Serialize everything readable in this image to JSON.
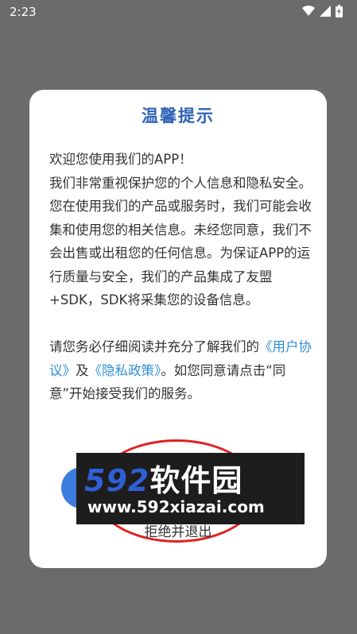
{
  "status_bar": {
    "time": "2:23"
  },
  "dialog": {
    "title": "温馨提示",
    "p1": "欢迎您使用我们的APP！",
    "p2": "我们非常重视保护您的个人信息和隐私安全。您在使用我们的产品或服务时，我们可能会收集和使用您的相关信息。未经您同意，我们不会出售或出租您的任何信息。为保证APP的运行质量与安全，我们的产品集成了友盟+SDK，SDK将采集您的设备信息。",
    "p3_before": "请您务必仔细阅读并充分了解我们的",
    "user_agreement_link": "《用户协议》",
    "and": "及",
    "privacy_policy_link": "《隐私政策》",
    "p3_after": "。如您同意请点击“同意”开始接受我们的服务。",
    "decline_label": "拒绝并退出"
  },
  "watermark": {
    "logo_num": "592",
    "logo_cn": "软件园",
    "url": "www.592xiazai.com"
  },
  "colors": {
    "title": "#2d62b5",
    "link": "#2e8fd8",
    "agree_button": "#3e7de0",
    "overlay": "#6b6b6b"
  }
}
